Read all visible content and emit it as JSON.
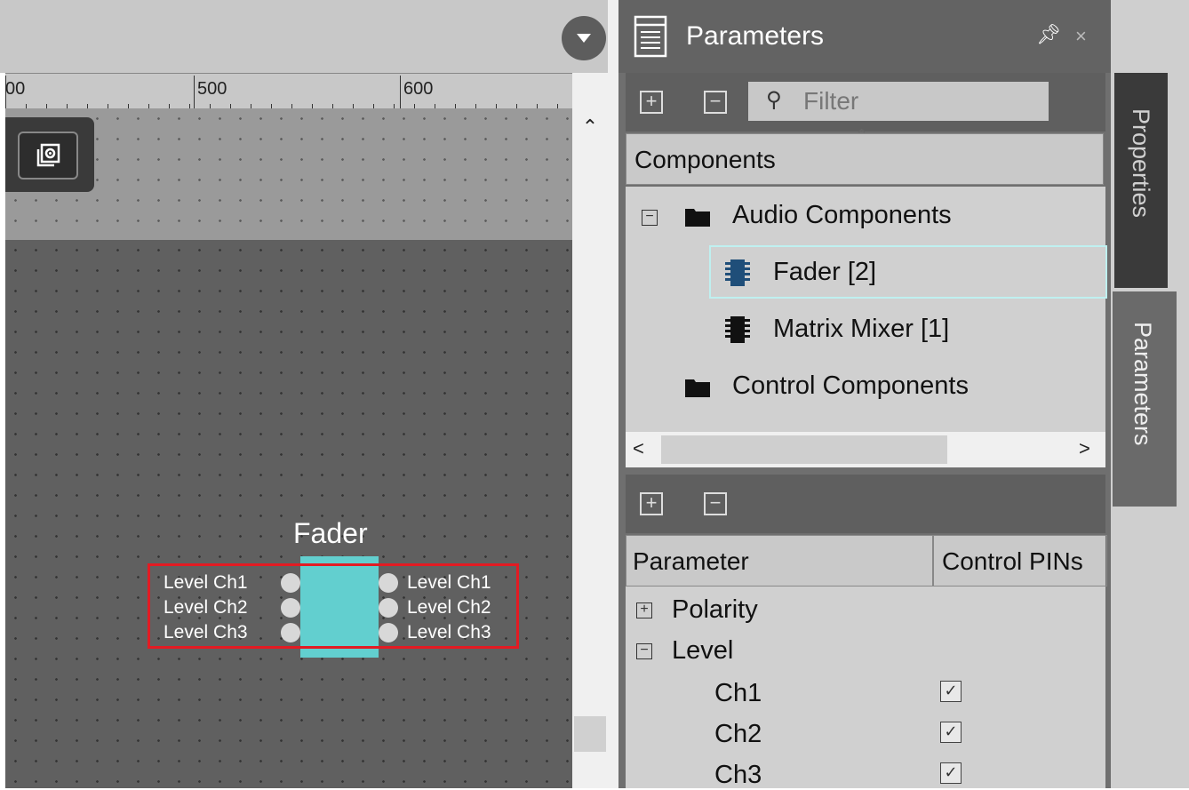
{
  "ruler": {
    "labels": [
      "00",
      "500",
      "600"
    ]
  },
  "canvas": {
    "component": {
      "title": "Fader",
      "inputs": [
        "Level Ch1",
        "Level Ch2",
        "Level Ch3"
      ],
      "outputs": [
        "Level Ch1",
        "Level Ch2",
        "Level Ch3"
      ]
    }
  },
  "panel": {
    "title": "Parameters",
    "filter_placeholder": "Filter",
    "components_header": "Components",
    "tree": {
      "audio_group": "Audio Components",
      "fader_item": "Fader [2]",
      "matrix_item": "Matrix Mixer [1]",
      "control_group": "Control Components"
    },
    "param_columns": {
      "parameter": "Parameter",
      "control_pins": "Control PINs"
    },
    "params": {
      "polarity": "Polarity",
      "level": "Level",
      "channels": [
        "Ch1",
        "Ch2",
        "Ch3"
      ]
    }
  },
  "side_tabs": {
    "properties": "Properties",
    "parameters": "Parameters"
  },
  "colors": {
    "fader_body": "#62cfcf",
    "selection": "#e31b23",
    "canvas": "#606060"
  },
  "icons": [
    "chevron-down-icon",
    "settings-icon",
    "panel-list-icon",
    "pin-icon",
    "close-icon",
    "search-icon",
    "folder-icon",
    "chip-icon",
    "plus-icon",
    "minus-icon",
    "checkbox-icon"
  ]
}
